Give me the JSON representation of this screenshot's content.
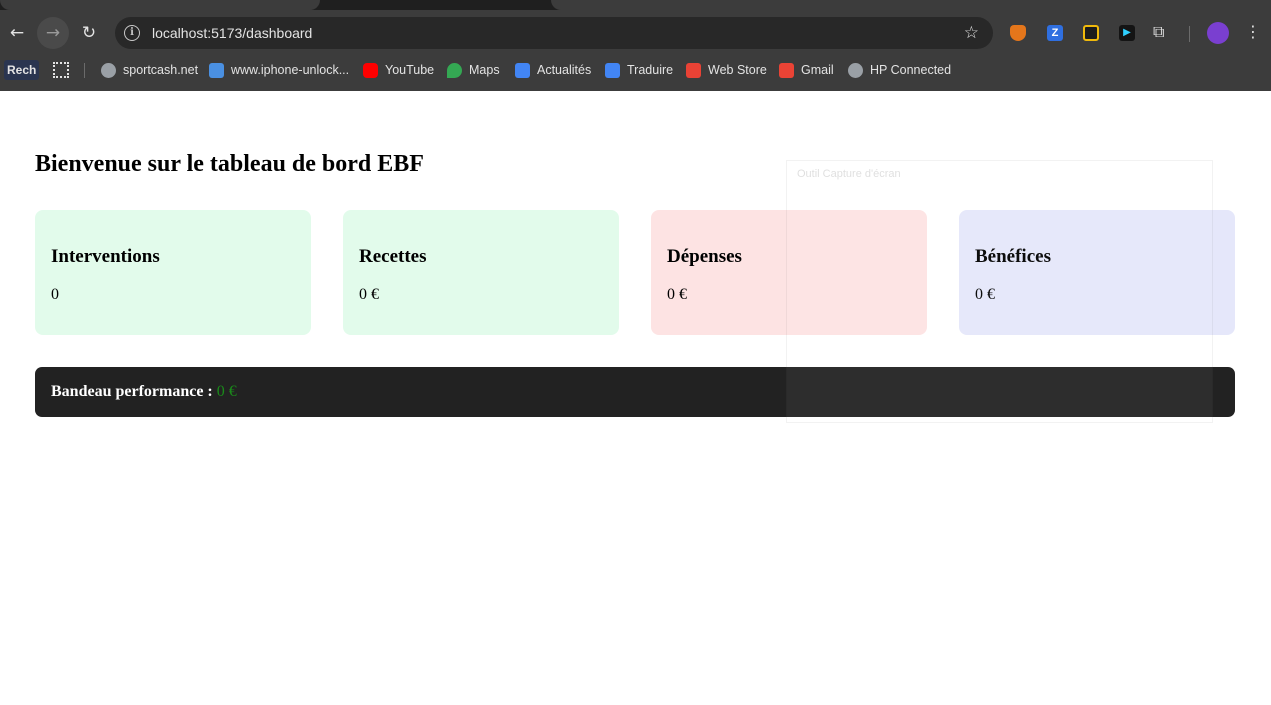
{
  "browser": {
    "url": "localhost:5173/dashboard",
    "bookmarks": [
      {
        "label": "sportcash.net",
        "icon": "globe-icon"
      },
      {
        "label": "www.iphone-unlock...",
        "icon": "image-icon"
      },
      {
        "label": "YouTube",
        "icon": "youtube-icon"
      },
      {
        "label": "Maps",
        "icon": "maps-icon"
      },
      {
        "label": "Actualités",
        "icon": "news-icon"
      },
      {
        "label": "Traduire",
        "icon": "translate-icon"
      },
      {
        "label": "Web Store",
        "icon": "webstore-icon"
      },
      {
        "label": "Gmail",
        "icon": "gmail-icon"
      },
      {
        "label": "HP Connected",
        "icon": "globe-icon"
      }
    ],
    "search_chip": "Rech"
  },
  "dashboard": {
    "title": "Bienvenue sur le tableau de bord EBF",
    "cards": [
      {
        "label": "Interventions",
        "value": "0",
        "color": "#e2fbeb"
      },
      {
        "label": "Recettes",
        "value": "0 €",
        "color": "#e2fbeb"
      },
      {
        "label": "Dépenses",
        "value": "0 €",
        "color": "#fde3e3"
      },
      {
        "label": "Bénéfices",
        "value": "0 €",
        "color": "#e5e7fa"
      }
    ],
    "banner": {
      "label": "Bandeau performance :",
      "value": "0 €",
      "value_color": "#1a8a1a",
      "background": "#222222"
    }
  },
  "overlay": {
    "label": "Outil Capture d'écran"
  }
}
